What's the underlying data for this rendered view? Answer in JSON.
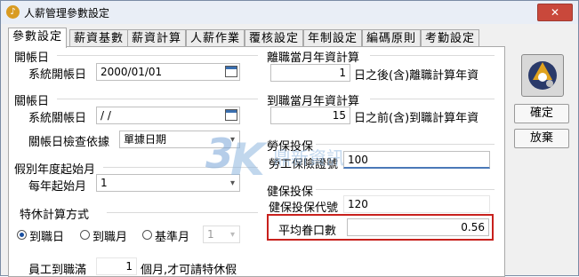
{
  "window": {
    "title": "人薪管理參數設定",
    "close_label": "✕"
  },
  "tabs": [
    {
      "label": "參數設定",
      "active": true
    },
    {
      "label": "薪資基數",
      "active": false
    },
    {
      "label": "薪資計算",
      "active": false
    },
    {
      "label": "人薪作業",
      "active": false
    },
    {
      "label": "覆核設定",
      "active": false
    },
    {
      "label": "年制設定",
      "active": false
    },
    {
      "label": "編碼原則",
      "active": false
    },
    {
      "label": "考勤設定",
      "active": false
    }
  ],
  "open_account": {
    "group_title": "開帳日",
    "label": "系統開帳日",
    "value": "2000/01/01"
  },
  "close_account": {
    "group_title": "關帳日",
    "label": "系統關帳日",
    "value": " / /",
    "check_label": "關帳日檢查依據",
    "check_value": "單據日期"
  },
  "leave_year": {
    "group_title": "假別年度起始月",
    "label": "每年起始月",
    "value": "1"
  },
  "special_leave": {
    "group_title": "特休計算方式",
    "options": [
      "到職日",
      "到職月",
      "基準月"
    ],
    "selected_index": 0,
    "base_month_value": "1",
    "employee_label": "員工到職滿",
    "months_value": "1",
    "months_suffix": "個月,才可請特休假"
  },
  "resign_year": {
    "group_title": "離職當月年資計算",
    "value": "1",
    "suffix": "日之後(含)離職計算年資"
  },
  "hire_year": {
    "group_title": "到職當月年資計算",
    "value": "15",
    "suffix": "日之前(含)到職計算年資"
  },
  "labor_insurance": {
    "group_title": "勞保投保",
    "label": "勞工保險證號",
    "value": "100"
  },
  "health_insurance": {
    "group_title": "健保投保",
    "code_label": "健保投保代號",
    "code_value": "120",
    "avg_label": "平均眷口數",
    "avg_value": "0.56"
  },
  "side": {
    "confirm_label": "確定",
    "cancel_label": "放棄"
  },
  "watermark_text": "鼎新資訊",
  "colors": {
    "highlight": "#c8211d",
    "close_button": "#c9483b",
    "title_icon": "#d99b21"
  }
}
